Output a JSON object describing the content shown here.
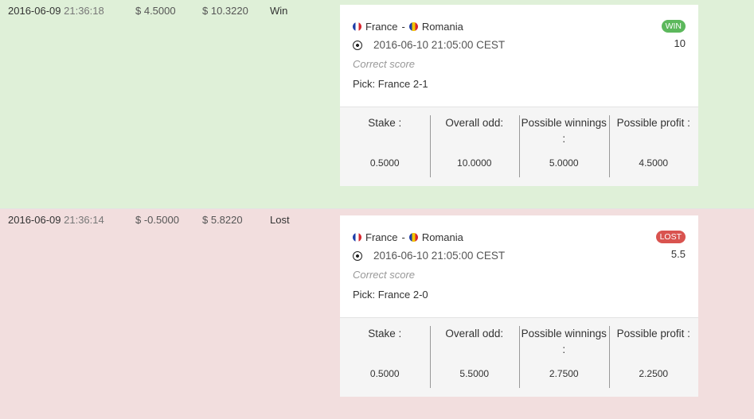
{
  "bets": [
    {
      "date": "2016-06-09",
      "time": "21:36:18",
      "profit": "$ 4.5000",
      "balance": "$ 10.3220",
      "result": "Win",
      "status": "win",
      "home_team": "France",
      "separator": "-",
      "away_team": "Romania",
      "event_time": "2016-06-10 21:05:00 CEST",
      "market": "Correct score",
      "pick": "Pick: France 2-1",
      "badge": "WIN",
      "odd": "10",
      "stake_label": "Stake :",
      "overall_odd_label": "Overall odd:",
      "possible_winnings_label": "Possible winnings :",
      "possible_profit_label": "Possible profit :",
      "stake": "0.5000",
      "overall_odd": "10.0000",
      "possible_winnings": "5.0000",
      "possible_profit": "4.5000"
    },
    {
      "date": "2016-06-09",
      "time": "21:36:14",
      "profit": "$ -0.5000",
      "balance": "$ 5.8220",
      "result": "Lost",
      "status": "lost",
      "home_team": "France",
      "separator": "-",
      "away_team": "Romania",
      "event_time": "2016-06-10 21:05:00 CEST",
      "market": "Correct score",
      "pick": "Pick: France 2-0",
      "badge": "LOST",
      "odd": "5.5",
      "stake_label": "Stake :",
      "overall_odd_label": "Overall odd:",
      "possible_winnings_label": "Possible winnings :",
      "possible_profit_label": "Possible profit :",
      "stake": "0.5000",
      "overall_odd": "5.5000",
      "possible_winnings": "2.7500",
      "possible_profit": "2.2500"
    }
  ],
  "colors": {
    "win_row": "#dff0d8",
    "lost_row": "#f2dede",
    "win_badge": "#5cb85c",
    "lost_badge": "#d9534f"
  },
  "icons": {
    "home_flag": "france-flag-icon",
    "away_flag": "romania-flag-icon",
    "sport": "soccer-ball-icon"
  }
}
